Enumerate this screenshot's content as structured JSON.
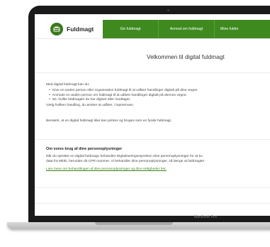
{
  "device": {
    "model_label": "MacBook Pro"
  },
  "header": {
    "brand": "Fuldmagt",
    "nav": [
      {
        "label": "Giv fuldmagt"
      },
      {
        "label": "Anmod om fuldmagt"
      },
      {
        "label": "Mine fuldm"
      }
    ]
  },
  "main": {
    "welcome": "Velkommen til digital fuldmagt",
    "intro": "Med digital fuldmagt kan du:",
    "bullets": [
      "Give en anden person eller organisation fuldmagt til at udføre handlinger digitalt på dine vegne.",
      "Anmode en anden person om fuldmagt til at udføre handlinger digitalt på dennes vegne.",
      "Se, hvilke fuldmagter du har afgivet eller modtaget."
    ],
    "choose": "Vælg hvilken handling, du ønsker at udføre, i topmenuen.",
    "note": "Bemærk, at en digital fuldmagt ikke kan printes og bruges som en fysisk fuldmagt.",
    "personal_data": {
      "title": "Om vores brug af dine personoplysninger",
      "line1": "Når du opretter en digital fuldmagt, behandler Digitaliseringsstyrelsen dine personoplysninger for at ku",
      "line2": "data fra MitID, herunder dit CPR nummer. Vi behandler dine personoplysninger, så længe at fuldmagter",
      "link": "Læs mere om behandlingen af dine personoplysninger og dine rettigheder her."
    }
  },
  "colors": {
    "brand_green": "#3f8a1f",
    "link_green": "#3f7f1f"
  }
}
